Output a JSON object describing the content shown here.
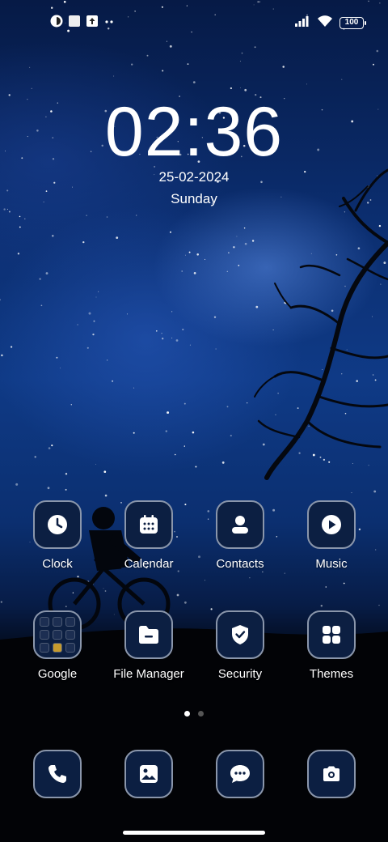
{
  "status_bar": {
    "left_icons": [
      "app-notification-icon",
      "square-notification-icon",
      "upload-icon",
      "more-dots-icon"
    ],
    "right_icons": [
      "signal-icon",
      "wifi-icon",
      "battery-icon"
    ],
    "battery_level": "100"
  },
  "lockclock": {
    "time": "02:36",
    "date": "25-02-2024",
    "day": "Sunday"
  },
  "apps": [
    {
      "label": "Clock",
      "icon": "clock-icon"
    },
    {
      "label": "Calendar",
      "icon": "calendar-icon"
    },
    {
      "label": "Contacts",
      "icon": "contacts-icon"
    },
    {
      "label": "Music",
      "icon": "music-icon"
    },
    {
      "label": "Google",
      "icon": "google-folder-icon"
    },
    {
      "label": "File Manager",
      "icon": "folder-icon"
    },
    {
      "label": "Security",
      "icon": "shield-icon"
    },
    {
      "label": "Themes",
      "icon": "themes-icon"
    }
  ],
  "dock": [
    {
      "icon": "phone-icon"
    },
    {
      "icon": "gallery-icon"
    },
    {
      "icon": "messages-icon"
    },
    {
      "icon": "camera-icon"
    }
  ],
  "pages": {
    "count": 2,
    "current": 1
  },
  "colors": {
    "icon_bg": "#0c1f42",
    "icon_border": "#8a96ab"
  }
}
